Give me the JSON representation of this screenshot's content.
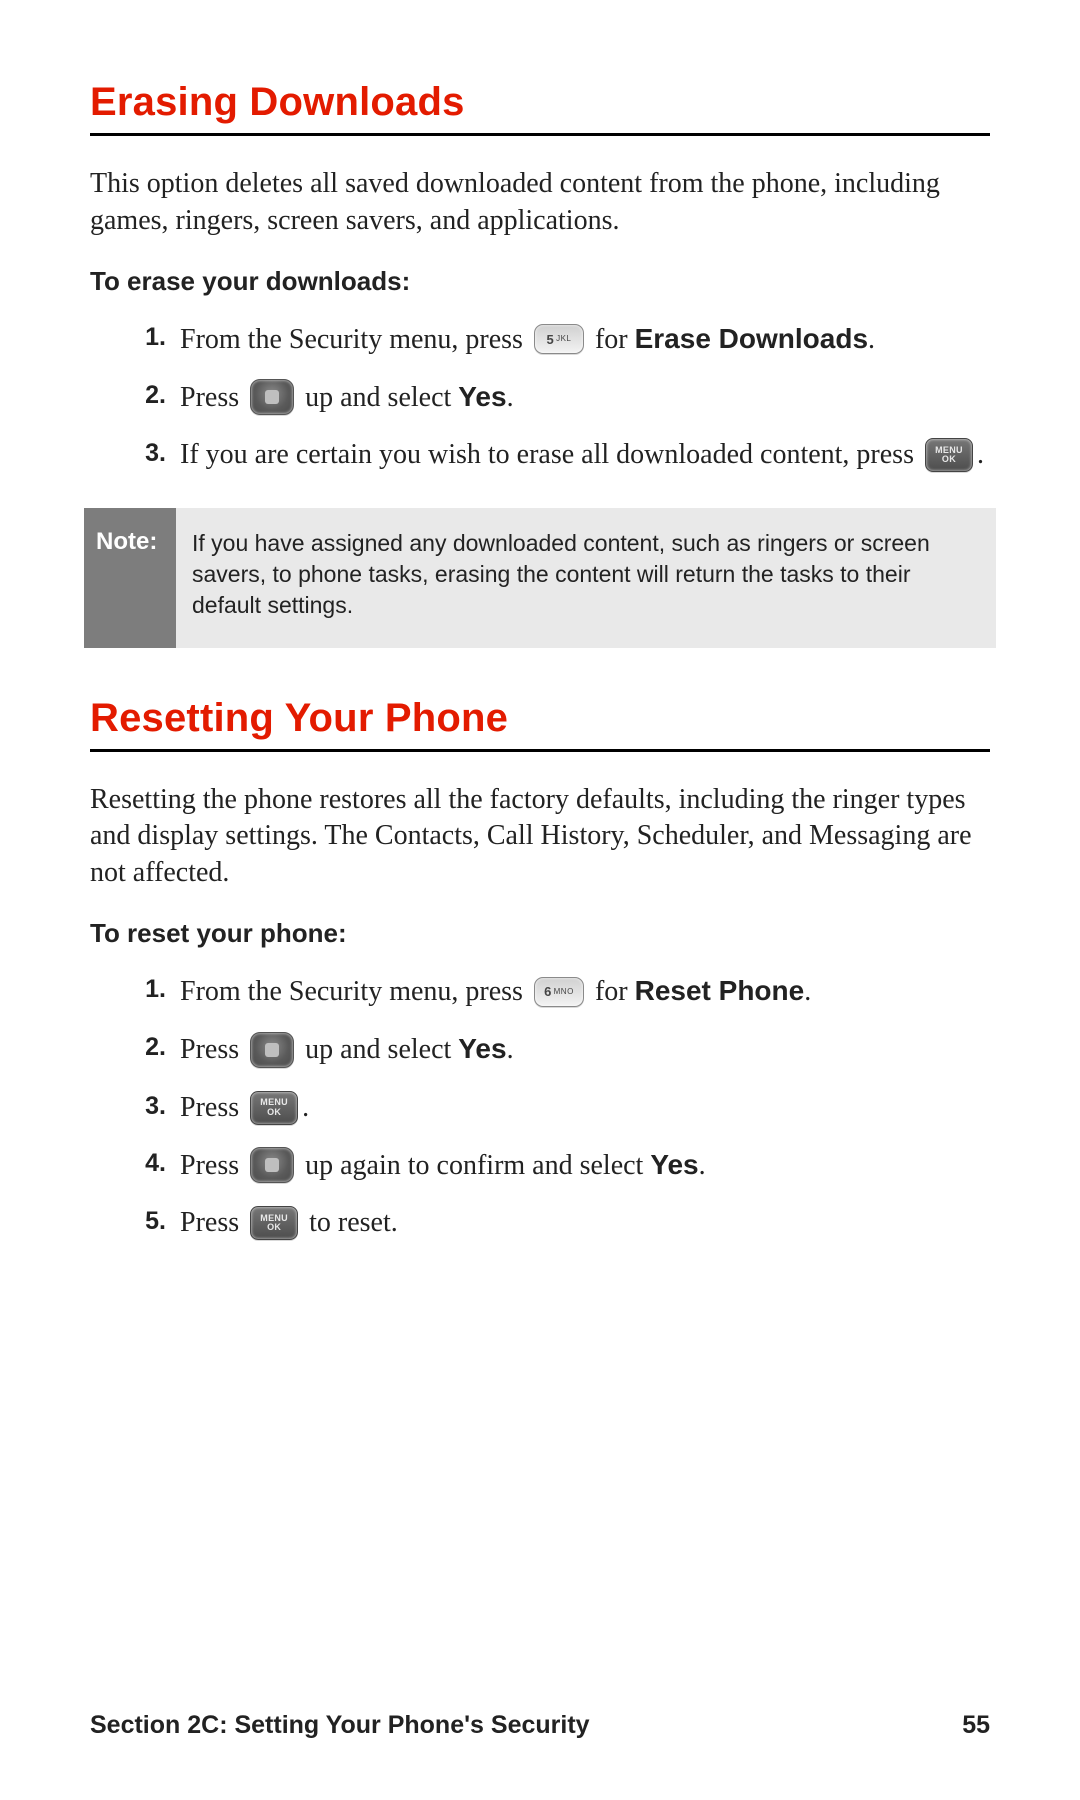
{
  "section_a": {
    "title": "Erasing Downloads",
    "intro": "This option deletes all saved downloaded content from the phone, including games, ringers, screen savers, and applications.",
    "lead": "To erase your downloads:",
    "steps": [
      {
        "num": "1.",
        "pre": "From the Security menu, press ",
        "key_type": "num5",
        "mid": " for ",
        "bold": "Erase Downloads",
        "post": "."
      },
      {
        "num": "2.",
        "pre": "Press ",
        "key_type": "nav",
        "mid": " up and select ",
        "bold": "Yes",
        "post": "."
      },
      {
        "num": "3.",
        "pre": "If you are certain you wish to erase all downloaded content, press ",
        "key_type": "menuok",
        "mid": "",
        "bold": "",
        "post": "."
      }
    ],
    "note_label": "Note:",
    "note_text": "If you have assigned any downloaded content, such as ringers or screen savers, to phone tasks, erasing the content will return the tasks to their default settings."
  },
  "section_b": {
    "title": "Resetting Your Phone",
    "intro": "Resetting the phone restores all the factory defaults, including the ringer types and display settings. The Contacts, Call History, Scheduler, and Messaging are not affected.",
    "lead": "To reset your phone:",
    "steps": [
      {
        "num": "1.",
        "pre": "From the Security menu, press ",
        "key_type": "num6",
        "mid": " for ",
        "bold": "Reset Phone",
        "post": "."
      },
      {
        "num": "2.",
        "pre": "Press ",
        "key_type": "nav",
        "mid": " up and select ",
        "bold": "Yes",
        "post": "."
      },
      {
        "num": "3.",
        "pre": "Press ",
        "key_type": "menuok",
        "mid": "",
        "bold": "",
        "post": "."
      },
      {
        "num": "4.",
        "pre": "Press ",
        "key_type": "nav",
        "mid": " up again to confirm and select ",
        "bold": "Yes",
        "post": "."
      },
      {
        "num": "5.",
        "pre": "Press ",
        "key_type": "menuok",
        "mid": "",
        "bold": "",
        "post": " to reset."
      }
    ]
  },
  "keys": {
    "num5": {
      "main": "5",
      "sub": "JKL"
    },
    "num6": {
      "main": "6",
      "sub": "MNO"
    },
    "menuok_line1": "MENU",
    "menuok_line2": "OK"
  },
  "footer": {
    "section": "Section 2C: Setting Your Phone's Security",
    "page": "55"
  }
}
